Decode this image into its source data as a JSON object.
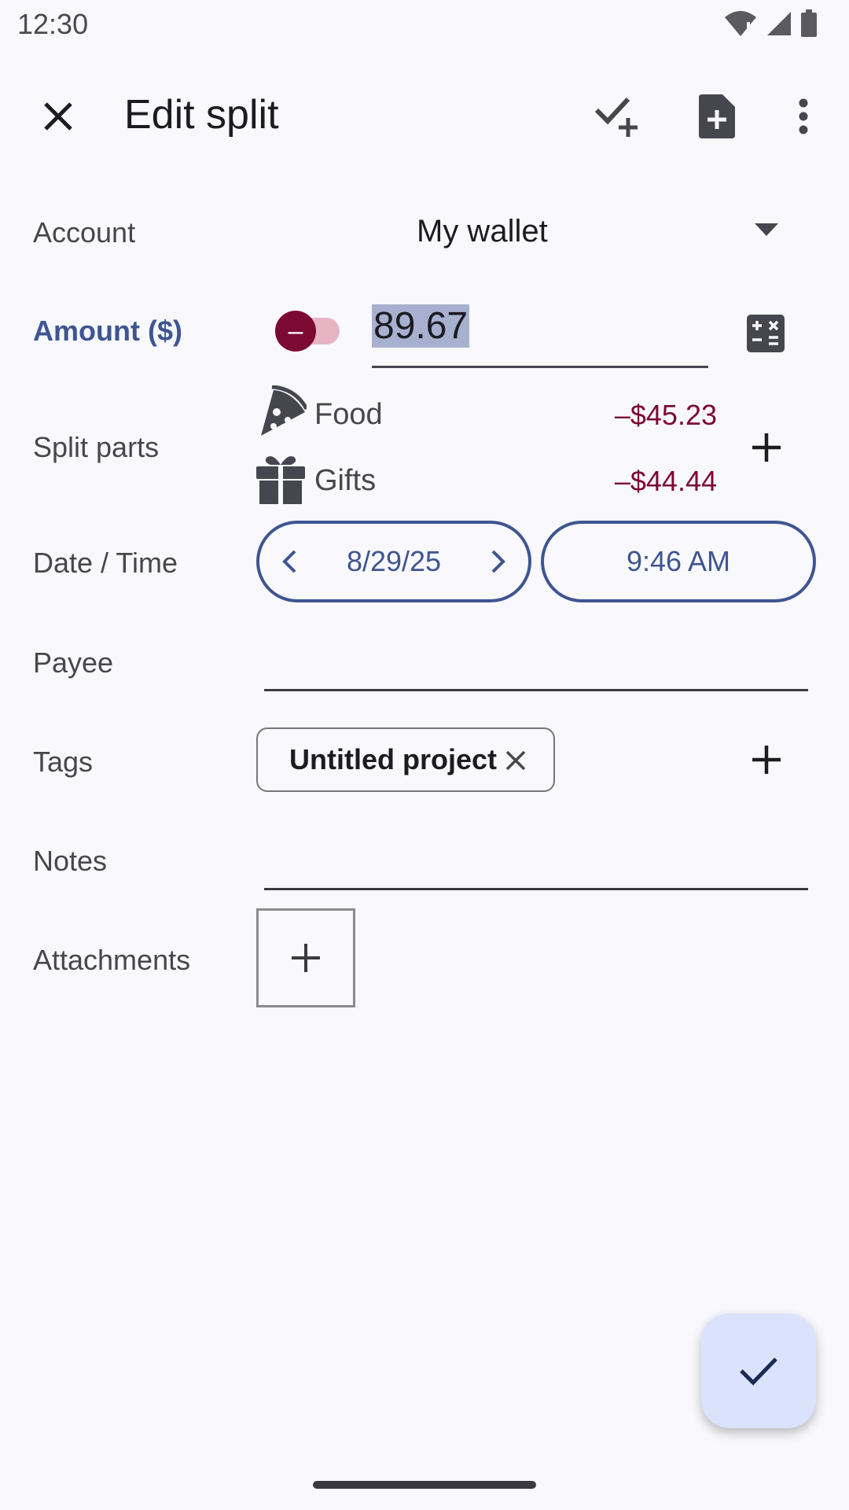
{
  "status_bar": {
    "time": "12:30"
  },
  "app_bar": {
    "title": "Edit split",
    "close_icon": "close-icon",
    "save_and_new_icon": "check-plus-icon",
    "new_from_template_icon": "note-plus-icon",
    "more_icon": "more-vert-icon"
  },
  "form": {
    "account": {
      "label": "Account",
      "value": "My wallet"
    },
    "amount": {
      "label": "Amount ($)",
      "sign": "–",
      "value": "89.67"
    },
    "split_parts": {
      "label": "Split parts",
      "items": [
        {
          "icon": "pizza-icon",
          "category": "Food",
          "amount": "–$45.23"
        },
        {
          "icon": "gift-icon",
          "category": "Gifts",
          "amount": "–$44.44"
        }
      ]
    },
    "date_time": {
      "label": "Date / Time",
      "date": "8/29/25",
      "time": "9:46 AM"
    },
    "payee": {
      "label": "Payee",
      "value": ""
    },
    "tags": {
      "label": "Tags",
      "items": [
        "Untitled project"
      ]
    },
    "notes": {
      "label": "Notes",
      "value": ""
    },
    "attachments": {
      "label": "Attachments"
    }
  },
  "colors": {
    "accent": "#3e5591",
    "expense": "#7c0932",
    "background": "#f8f8fd",
    "fab": "#dbe2fb"
  }
}
